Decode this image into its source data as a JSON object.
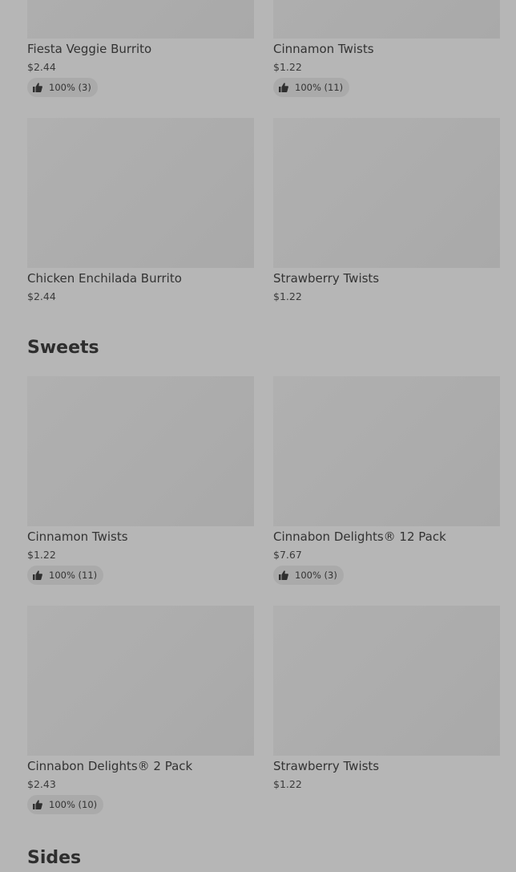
{
  "top_row": [
    {
      "name": "Fiesta Veggie Burrito",
      "price": "$2.44",
      "rating": "100% (3)"
    },
    {
      "name": "Cinnamon Twists",
      "price": "$1.22",
      "rating": "100% (11)"
    }
  ],
  "row2": [
    {
      "name": "Chicken Enchilada Burrito",
      "price": "$2.44"
    },
    {
      "name": "Strawberry Twists",
      "price": "$1.22"
    }
  ],
  "sweets": {
    "title": "Sweets",
    "items": [
      {
        "name": "Cinnamon Twists",
        "price": "$1.22",
        "rating": "100% (11)"
      },
      {
        "name": "Cinnabon Delights® 12 Pack",
        "price": "$7.67",
        "rating": "100% (3)"
      },
      {
        "name": "Cinnabon Delights® 2 Pack",
        "price": "$2.43",
        "rating": "100% (10)"
      },
      {
        "name": "Strawberry Twists",
        "price": "$1.22"
      }
    ]
  },
  "sides": {
    "title": "Sides"
  },
  "icons": {
    "rating": "thumbs-up-icon"
  }
}
